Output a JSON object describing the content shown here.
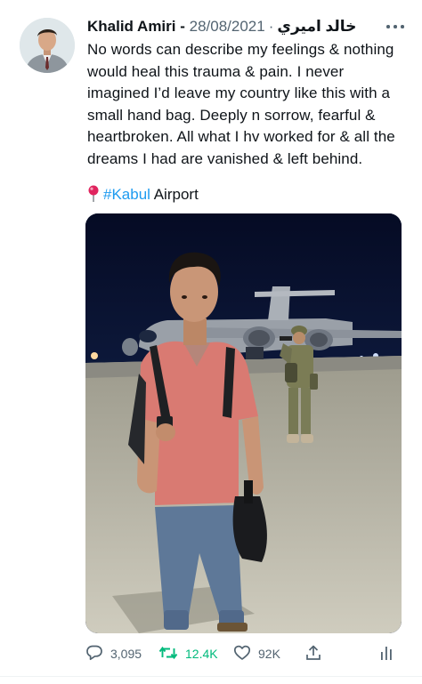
{
  "author": {
    "name": "Khalid Amiri - خالد اميري",
    "separator": "·",
    "date": "28/08/2021"
  },
  "tweet": {
    "text": "No words can describe my feelings & nothing would heal this trauma & pain. I never imagined I’d leave my country like this with a small hand bag. Deeply n sorrow, fearful & heartbroken. All what I hv worked for & all the dreams I had are vanished & left behind.",
    "location_hashtag": "#Kabul",
    "location_suffix": " Airport"
  },
  "icons": {
    "more": "more-dots-icon",
    "location": "round-pushpin-icon",
    "reply": "reply-icon",
    "retweet": "retweet-icon",
    "like": "heart-icon",
    "share": "share-icon",
    "analytics": "analytics-icon"
  },
  "stats": {
    "replies": "3,095",
    "retweets": "12.4K",
    "likes": "92K"
  },
  "colors": {
    "accent": "#1d9bf0",
    "retweet": "#00ba7c",
    "muted": "#536471",
    "pin": "#e0245e"
  }
}
